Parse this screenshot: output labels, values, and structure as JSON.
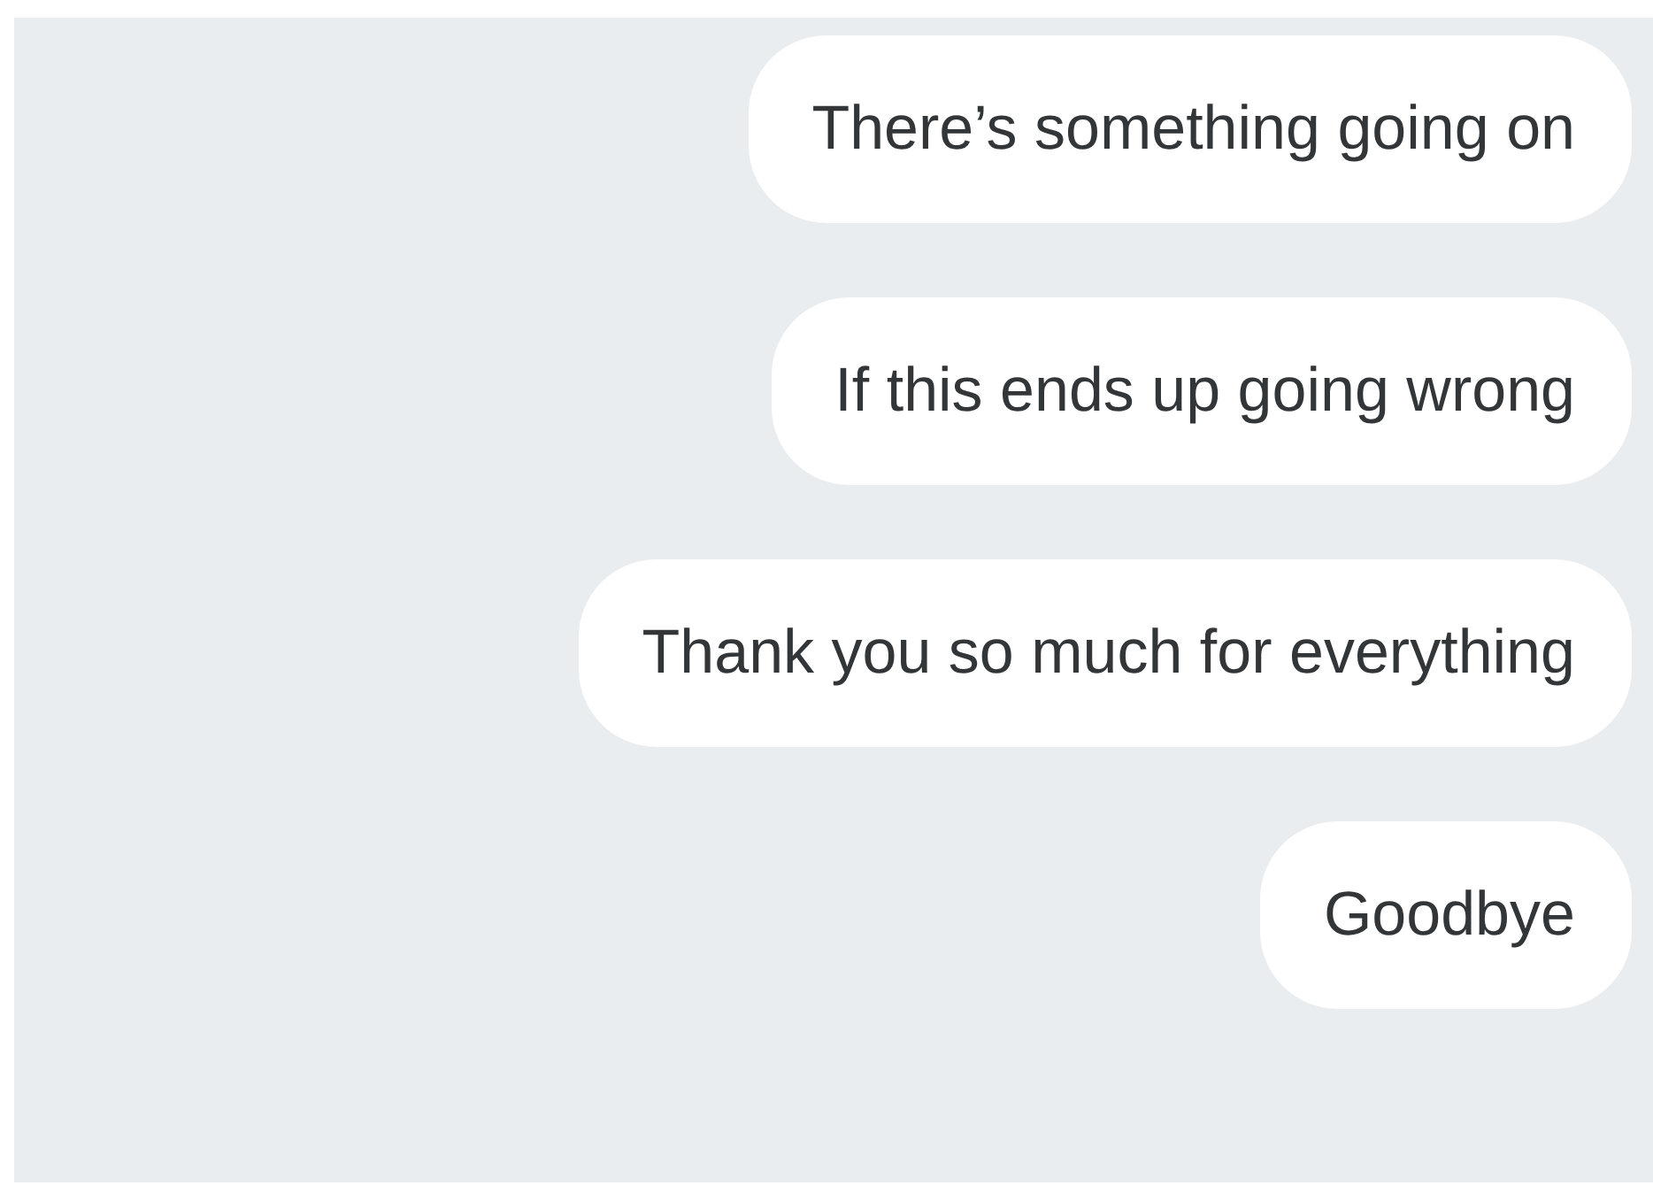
{
  "messages": [
    {
      "text": "There’s something going on"
    },
    {
      "text": "If this ends up going wrong"
    },
    {
      "text": "Thank you so much for everything"
    },
    {
      "text": "Goodbye"
    }
  ]
}
